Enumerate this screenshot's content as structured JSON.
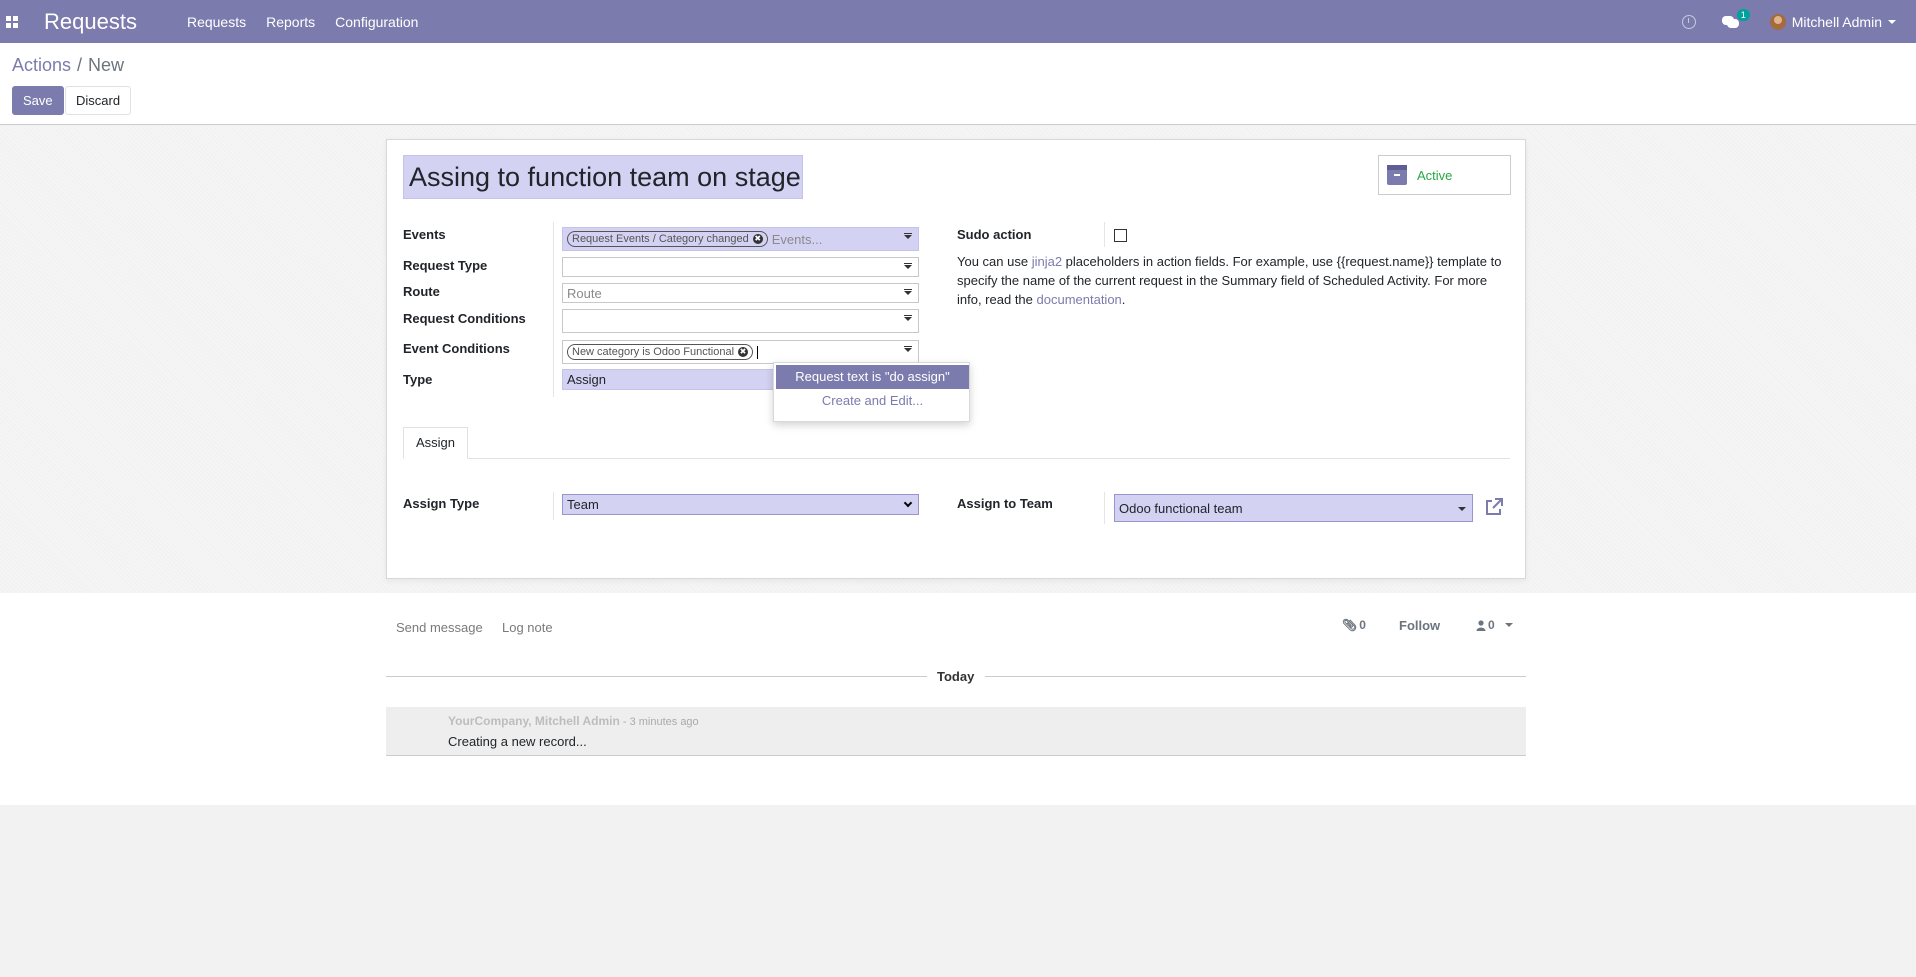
{
  "navbar": {
    "brand": "Requests",
    "menu": [
      "Requests",
      "Reports",
      "Configuration"
    ],
    "notification_count": "1",
    "user_name": "Mitchell Admin"
  },
  "breadcrumb": {
    "parent": "Actions",
    "separator": "/",
    "current": "New"
  },
  "buttons": {
    "save": "Save",
    "discard": "Discard"
  },
  "form": {
    "title": "Assing to function team on stage c",
    "active_label": "Active",
    "events": {
      "label": "Events",
      "tag": "Request Events / Category changed",
      "placeholder": "Events..."
    },
    "request_type": {
      "label": "Request Type",
      "value": ""
    },
    "route": {
      "label": "Route",
      "placeholder": "Route"
    },
    "request_conditions": {
      "label": "Request Conditions",
      "value": ""
    },
    "event_conditions": {
      "label": "Event Conditions",
      "tag": "New category is Odoo Functional"
    },
    "type": {
      "label": "Type",
      "value": "Assign"
    },
    "sudo_action": {
      "label": "Sudo action",
      "checked": false
    },
    "help": {
      "p1": "You can use ",
      "link1": "jinja2",
      "p2": " placeholders in action fields. For example, use {{request.name}} template to specify the name of the current request in the Summary field of Scheduled Activity. For more info, read the ",
      "link2": "documentation",
      "p3": "."
    },
    "autocomplete": {
      "option": "Request text is \"do assign\"",
      "create": "Create and Edit..."
    },
    "tab": "Assign",
    "assign_type": {
      "label": "Assign Type",
      "value": "Team"
    },
    "assign_to_team": {
      "label": "Assign to Team",
      "value": "Odoo functional team"
    }
  },
  "chatter": {
    "send_message": "Send message",
    "log_note": "Log note",
    "attachments": "0",
    "follow": "Follow",
    "followers": "0",
    "date_separator": "Today",
    "message": {
      "author": "YourCompany, Mitchell Admin",
      "time": " - 3 minutes ago",
      "body": "Creating a new record..."
    }
  },
  "colors": {
    "brand": "#7c7bad",
    "required_field": "#d3d2f3",
    "active": "#28a745"
  },
  "icons": [
    "apps-icon",
    "clock-icon",
    "chat-icon",
    "archive-icon",
    "external-link-icon",
    "paperclip-icon",
    "user-icon",
    "remove-tag-icon",
    "dropdown-caret-icon"
  ]
}
